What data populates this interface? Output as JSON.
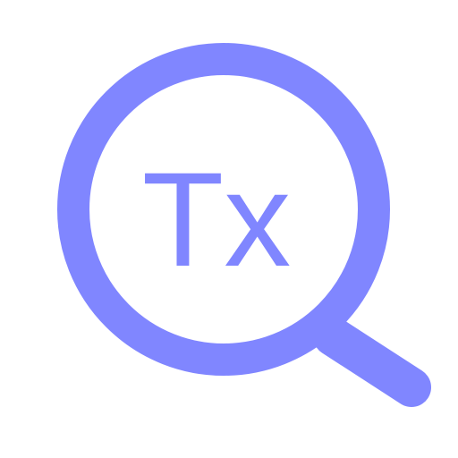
{
  "icon": {
    "name": "magnifier-text-icon",
    "text": "Tx",
    "color": "#8086FF",
    "background": "#FFFFFF"
  }
}
